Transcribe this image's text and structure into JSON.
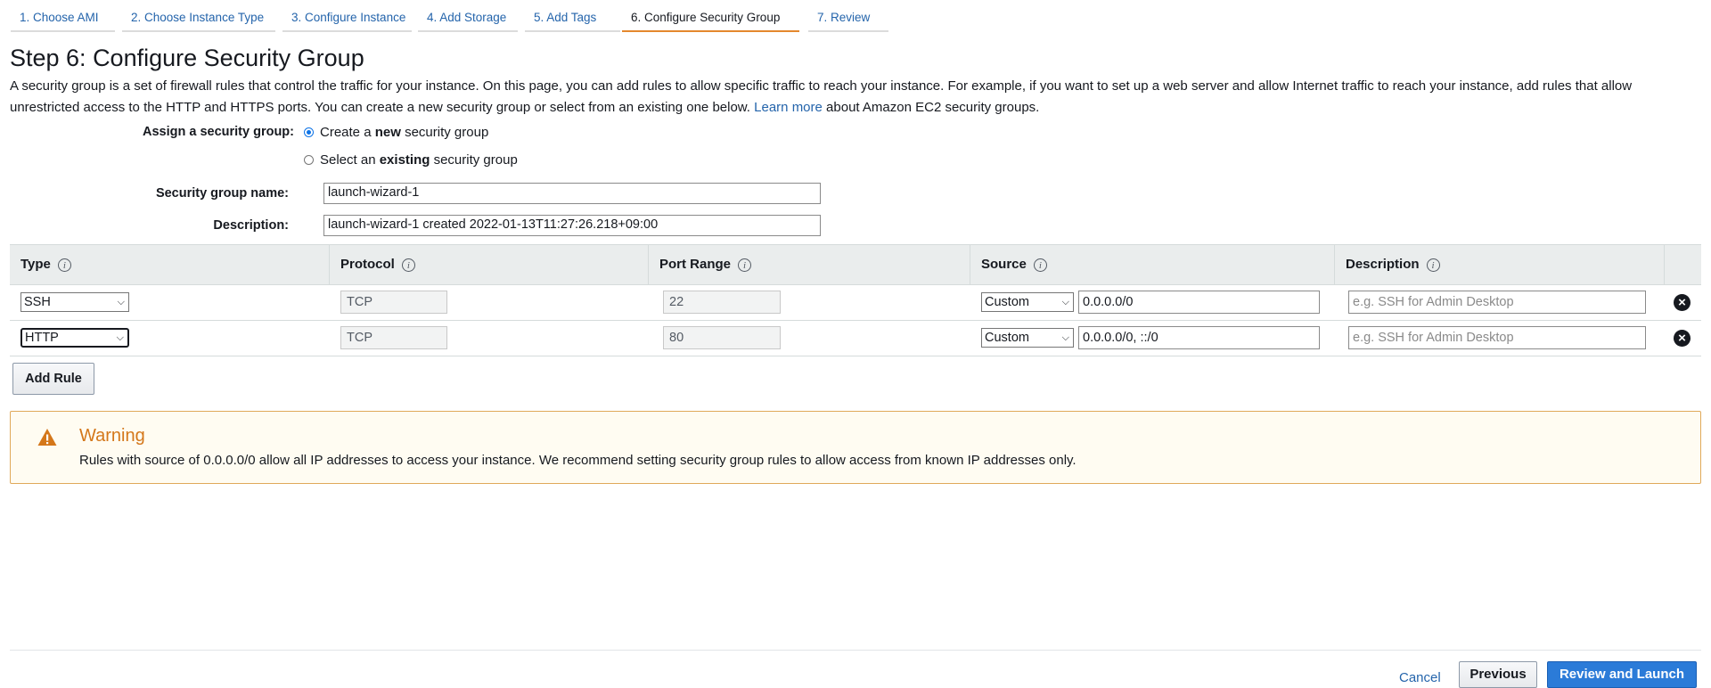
{
  "wizard": {
    "steps": [
      "1. Choose AMI",
      "2. Choose Instance Type",
      "3. Configure Instance",
      "4. Add Storage",
      "5. Add Tags",
      "6. Configure Security Group",
      "7. Review"
    ],
    "active_step": 6
  },
  "page": {
    "title": "Step 6: Configure Security Group",
    "intro_text": "A security group is a set of firewall rules that control the traffic for your instance. On this page, you can add rules to allow specific traffic to reach your instance. For example, if you want to set up a web server and allow Internet traffic to reach your instance, add rules that allow unrestricted access to the HTTP and HTTPS ports. You can create a new security group or select from an existing one below.",
    "learn_more_link": "Learn more",
    "intro_suffix": "about Amazon EC2 security groups."
  },
  "assign": {
    "label": "Assign a security group:",
    "option_new_prefix": "Create a",
    "option_new_bold": "new",
    "option_new_suffix": "security group",
    "option_existing_prefix": "Select an",
    "option_existing_bold": "existing",
    "option_existing_suffix": "security group",
    "selected": "new"
  },
  "group": {
    "name_label": "Security group name:",
    "name_value": "launch-wizard-1",
    "description_label": "Description:",
    "description_value": "launch-wizard-1 created 2022-01-13T11:27:26.218+09:00"
  },
  "rules_table": {
    "columns": [
      "Type",
      "Protocol",
      "Port Range",
      "Source",
      "Description"
    ],
    "rows": [
      {
        "type": "SSH",
        "protocol": "TCP",
        "port_range": "22",
        "source_mode": "Custom",
        "source_cidr": "0.0.0.0/0",
        "description_placeholder": "e.g. SSH for Admin Desktop"
      },
      {
        "type": "HTTP",
        "protocol": "TCP",
        "port_range": "80",
        "source_mode": "Custom",
        "source_cidr": "0.0.0.0/0, ::/0",
        "description_placeholder": "e.g. SSH for Admin Desktop"
      }
    ],
    "add_rule_label": "Add Rule"
  },
  "warning": {
    "title": "Warning",
    "text": "Rules with source of 0.0.0.0/0 allow all IP addresses to access your instance. We recommend setting security group rules to allow access from known IP addresses only.",
    "color": "#d4771a"
  },
  "footer": {
    "cancel_label": "Cancel",
    "previous_label": "Previous",
    "launch_label": "Review and Launch"
  },
  "colors": {
    "link": "#2464ab",
    "active_tab_underline": "#e4882e",
    "primary_button": "#2b7bd8"
  }
}
